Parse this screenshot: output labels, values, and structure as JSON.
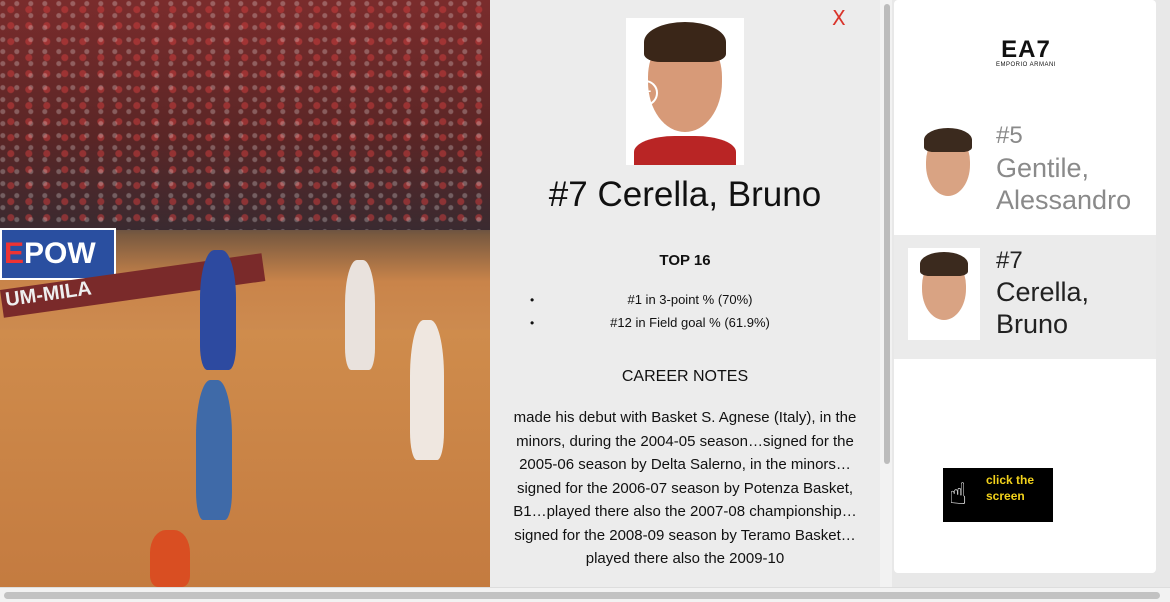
{
  "video": {
    "ad_board_prefix": "E",
    "ad_board_text": "POW",
    "court_text": "UM-MILA"
  },
  "profile": {
    "close_label": "X",
    "photo_action": "+",
    "player_name": "#7 Cerella, Bruno",
    "top_heading": "TOP 16",
    "stats": [
      "#1 in 3-point % (70%)",
      "#12 in Field goal % (61.9%)"
    ],
    "career_heading": "CAREER NOTES",
    "career_notes": "made his debut with Basket S. Agnese (Italy), in the minors, during the 2004-05 season…signed for the 2005-06 season by Delta Salerno, in the minors…signed for the 2006-07 season by Potenza Basket, B1…played there also the 2007-08 championship…signed for the 2008-09 season by Teramo Basket…played there also the 2009-10"
  },
  "sidebar": {
    "logo_main": "EA7",
    "logo_sub": "EMPORIO ARMANI",
    "roster": [
      {
        "number": "#5",
        "first": "Gentile,",
        "last": "Alessandro",
        "active": false
      },
      {
        "number": "#7",
        "first": "Cerella,",
        "last": "Bruno",
        "active": true
      }
    ],
    "click_hint": "click the screen"
  },
  "colors": {
    "close": "#d9342b",
    "hint_text": "#f2d21b",
    "active_row": "#ebebeb"
  }
}
